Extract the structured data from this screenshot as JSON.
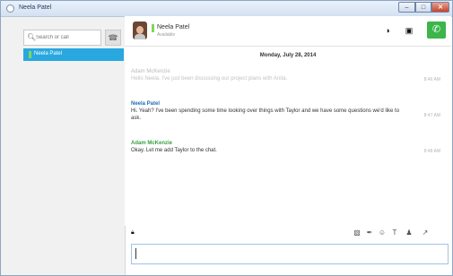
{
  "window": {
    "title": "Neela Patel"
  },
  "window_controls": {
    "minimize": "–",
    "maximize": "□",
    "close": "✕"
  },
  "sidebar": {
    "search": {
      "placeholder": "Search or call",
      "icon": "search-icon"
    },
    "dial_icon": "phone-icon",
    "contacts": [
      {
        "name": "Neela Patel",
        "status_color": "#7ed957",
        "selected": true
      }
    ]
  },
  "header": {
    "contact_name": "Neela Patel",
    "status": "Available",
    "presence_color": "#7ed957",
    "icons": [
      "contrast-icon",
      "contact-card-icon",
      "call-icon"
    ]
  },
  "conversation": {
    "date": "Monday, July 28, 2014",
    "messages": [
      {
        "sender": "Adam McKenzie",
        "text": "Hello Neela. I've just been discussing our project plans with Anita.",
        "time": "8:46 AM",
        "faded": true
      },
      {
        "sender": "Neela Patel",
        "text": "Hi. Yeah? I've been spending some time looking over things with Taylor and we have some questions we'd like to ask.",
        "time": "8:47 AM",
        "faded": false
      },
      {
        "sender": "Adam McKenzie",
        "text": "Okay. Let me add Taylor to the chat.",
        "time": "8:48 AM",
        "faded": false
      }
    ]
  },
  "toolbar": {
    "icons": [
      "screenshot-icon",
      "attach-icon",
      "emoji-icon",
      "text-format-icon",
      "add-person-icon",
      "popout-icon"
    ]
  },
  "colors": {
    "accent": "#29a8e0",
    "call_green": "#3cb54a",
    "sender_blue": "#1f6fb6",
    "sender_green": "#3aa143"
  }
}
